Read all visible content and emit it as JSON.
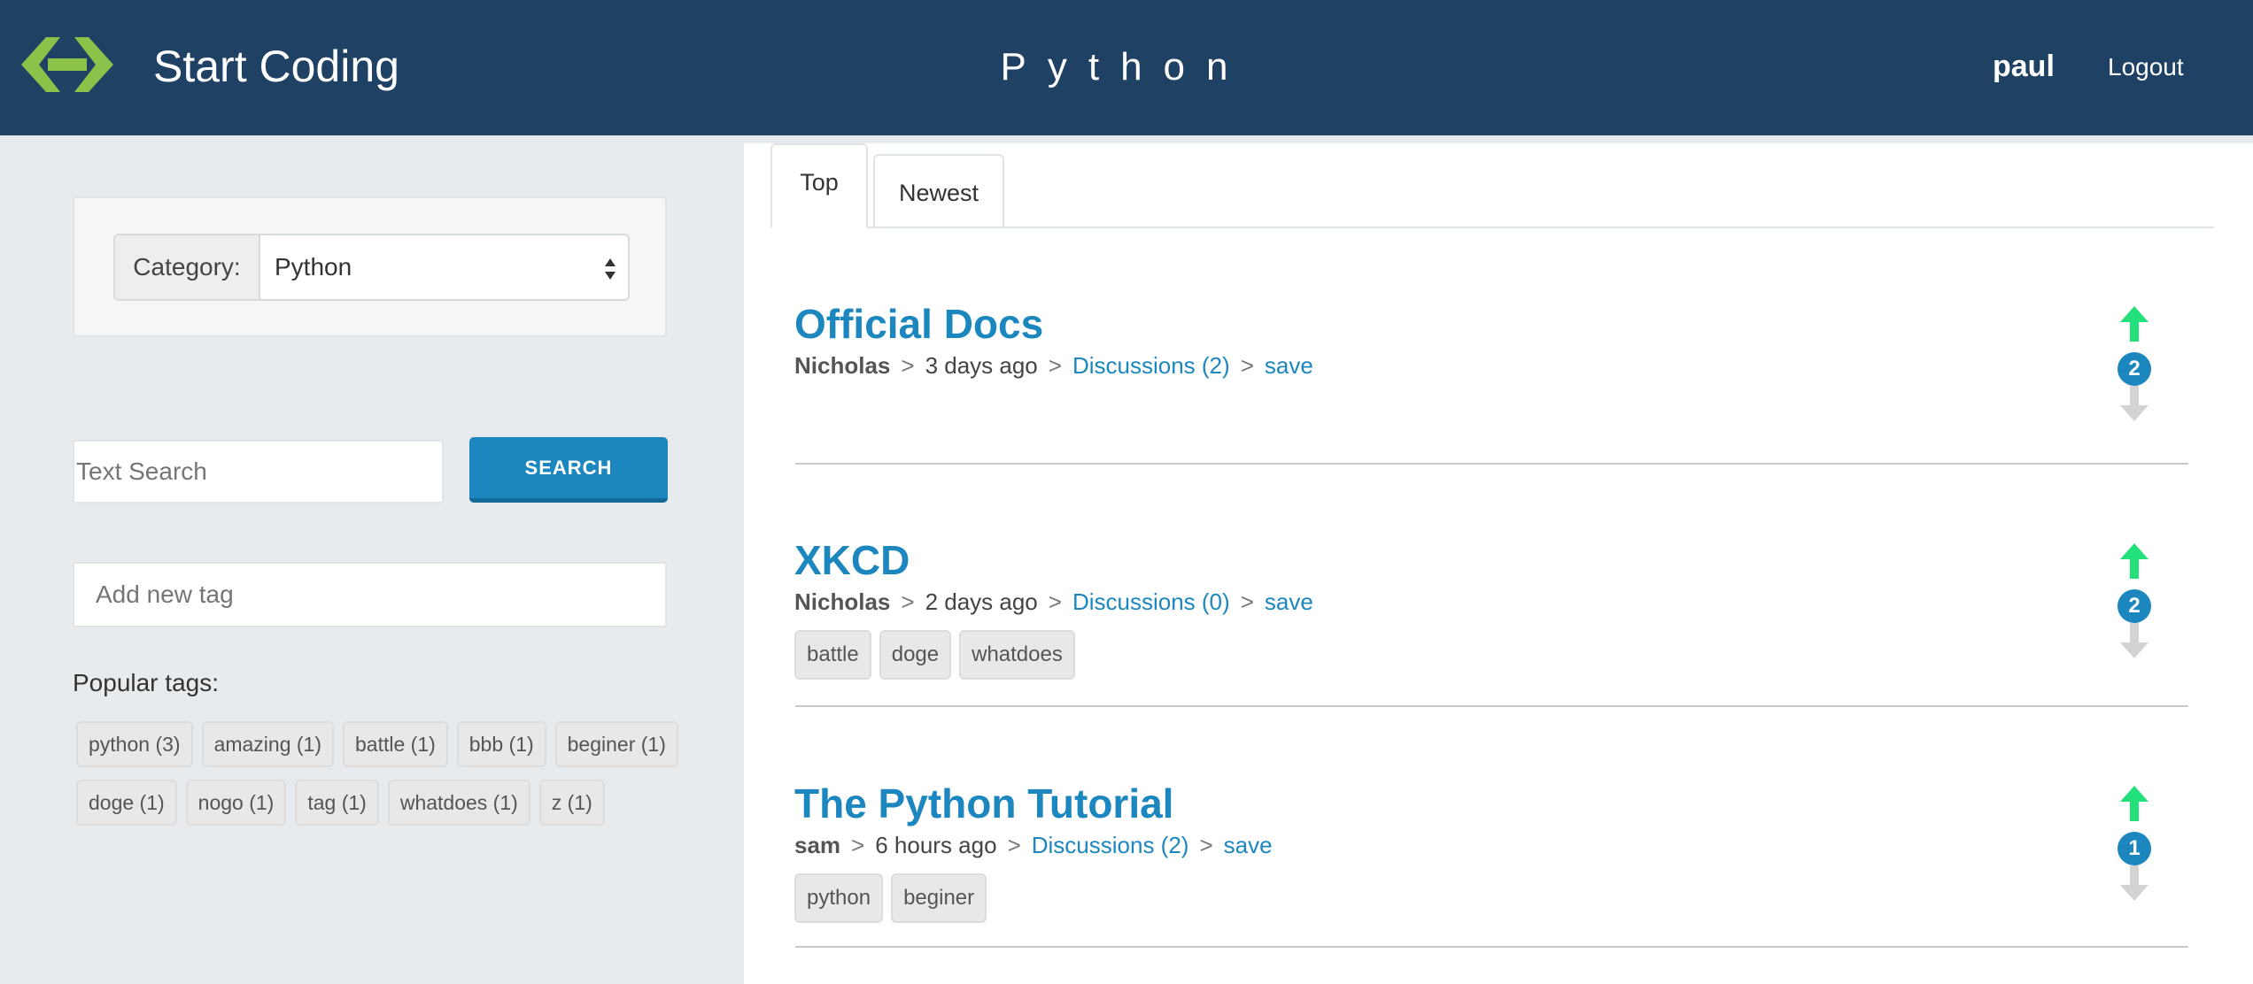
{
  "header": {
    "brand": "Start Coding",
    "page_title": "Python",
    "username": "paul",
    "logout_label": "Logout",
    "logo_icon": "code-brackets-icon",
    "colors": {
      "header_bg": "#1f4163",
      "logo": "#8bc34a",
      "accent": "#1b87be",
      "vote_up": "#22e07a"
    }
  },
  "sidebar": {
    "category_label": "Category:",
    "category_value": "Python",
    "search_placeholder": "Text Search",
    "search_button": "SEARCH",
    "tag_placeholder": "Add new tag",
    "popular_title": "Popular tags:",
    "popular_tags": [
      "python (3)",
      "amazing (1)",
      "battle (1)",
      "bbb (1)",
      "beginer (1)",
      "doge (1)",
      "nogo (1)",
      "tag (1)",
      "whatdoes (1)",
      "z (1)"
    ]
  },
  "tabs": [
    {
      "label": "Top",
      "active": true
    },
    {
      "label": "Newest",
      "active": false
    }
  ],
  "posts": [
    {
      "title": "Official Docs",
      "author": "Nicholas",
      "time": "3 days ago",
      "discussions": "Discussions (2)",
      "save": "save",
      "votes": "2",
      "tags": []
    },
    {
      "title": "XKCD",
      "author": "Nicholas",
      "time": "2 days ago",
      "discussions": "Discussions (0)",
      "save": "save",
      "votes": "2",
      "tags": [
        "battle",
        "doge",
        "whatdoes"
      ]
    },
    {
      "title": "The Python Tutorial",
      "author": "sam",
      "time": "6 hours ago",
      "discussions": "Discussions (2)",
      "save": "save",
      "votes": "1",
      "tags": [
        "python",
        "beginer"
      ]
    }
  ],
  "separator": ">"
}
